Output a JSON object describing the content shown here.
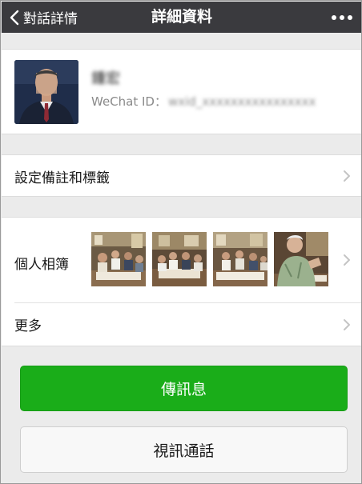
{
  "navbar": {
    "back_label": "對話詳情",
    "title": "詳細資料",
    "more_icon": "more-dots-icon"
  },
  "profile": {
    "name": "鍾宏",
    "wechat_id_label": "WeChat ID：",
    "wechat_id_value": "wxid_xxxxxxxxxxxxxxxx",
    "avatar_icon": "avatar-photo"
  },
  "menu": {
    "remarks_label": "設定備註和標籤",
    "album_label": "個人相簿",
    "more_label": "更多"
  },
  "album": {
    "thumbnails": [
      "meeting-photo",
      "meeting-photo",
      "meeting-photo",
      "meeting-photo"
    ]
  },
  "actions": {
    "message_label": "傳訊息",
    "video_call_label": "視訊通話"
  },
  "colors": {
    "navbar_bg": "#3a3a3e",
    "primary_button": "#1aad19",
    "background": "#ebebeb"
  }
}
